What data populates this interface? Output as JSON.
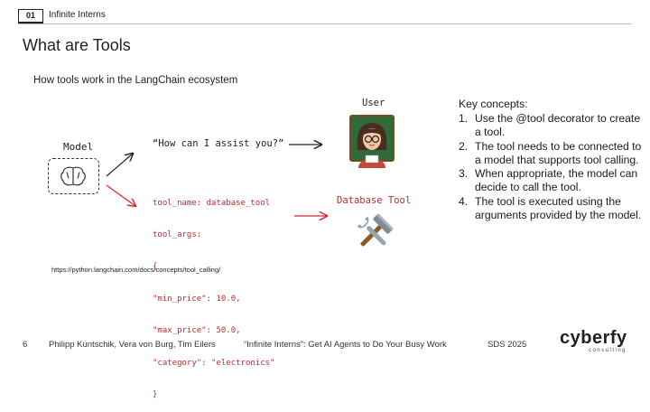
{
  "header": {
    "section_number": "01",
    "section_title": "Infinite Interns"
  },
  "slide": {
    "title": "What are Tools",
    "subtitle": "How tools work in the LangChain ecosystem"
  },
  "diagram": {
    "model_label": "Model",
    "user_label": "User",
    "prompt_text": "“How can I assist you?”",
    "tool_label": "Database Tool",
    "code_lines": [
      "tool_name: database_tool",
      "tool_args:",
      "{",
      "\"min_price\": 10.0,",
      "\"max_price\": 50.0,",
      "\"category\": \"electronics\"",
      "}"
    ],
    "colors": {
      "code": "#c0282d",
      "red_arrow": "#d6262b"
    },
    "icons": [
      "brain-icon",
      "user-avatar-icon",
      "tools-icon"
    ]
  },
  "reference_url": "https://python.langchain.com/docs/concepts/tool_calling/",
  "key_concepts": {
    "title": "Key concepts:",
    "items": [
      {
        "num": "1.",
        "text": "Use the @tool decorator to create a tool."
      },
      {
        "num": "2.",
        "text": "The tool needs to be connected to a model that supports tool calling."
      },
      {
        "num": "3.",
        "text": "When appropriate, the model can decide to call the tool."
      },
      {
        "num": "4.",
        "text": "The tool is executed using the arguments provided by the model."
      }
    ]
  },
  "footer": {
    "page_number": "6",
    "authors": "Philipp Kuntschik, Vera von Burg, Tim Eilers",
    "talk_title": "“Infinite Interns”: Get AI Agents to Do Your Busy Work",
    "event": "SDS 2025",
    "logo_main": "cyberfy",
    "logo_sub": "consulting"
  }
}
